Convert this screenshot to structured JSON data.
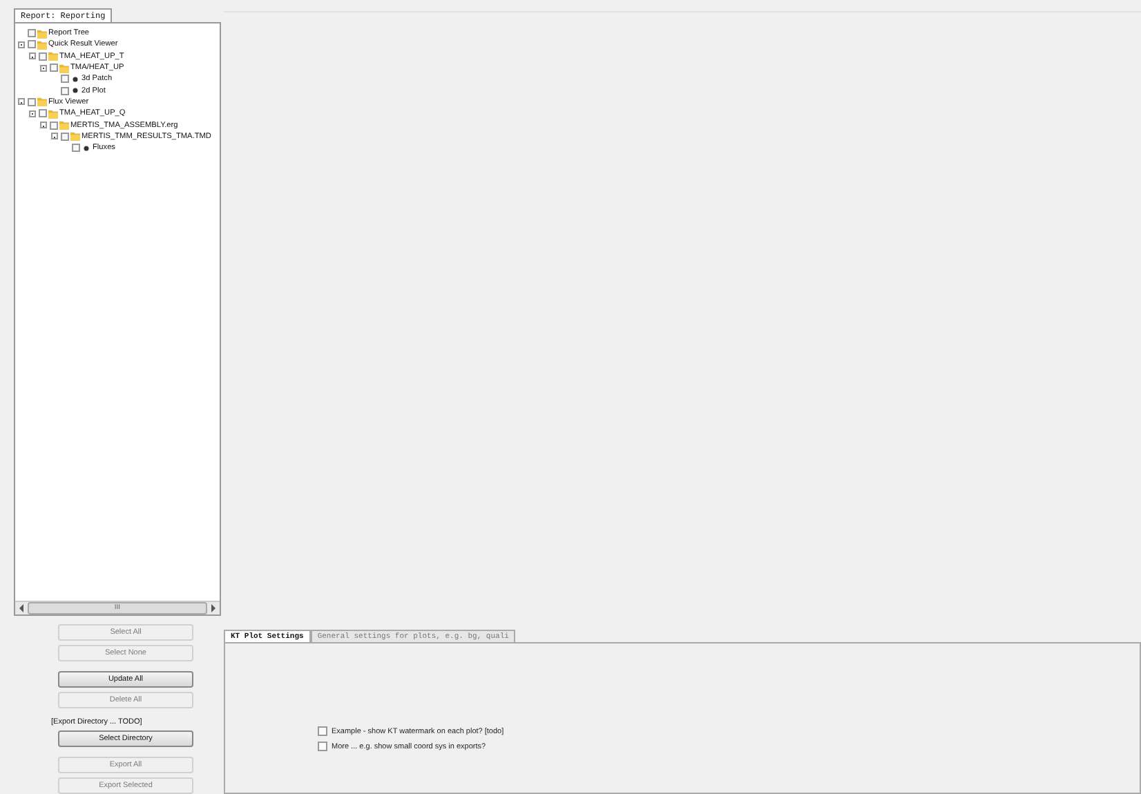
{
  "left_panel": {
    "tab": {
      "label": "Report: Reporting",
      "selected": true
    },
    "tree": [
      {
        "label": "Report Tree",
        "kind": "folder",
        "checked": false
      },
      {
        "label": "Quick Result Viewer",
        "kind": "folder",
        "checked": false,
        "expanded": true,
        "children": [
          {
            "label": "TMA_HEAT_UP_T",
            "kind": "folder",
            "checked": false,
            "expanded": true,
            "children": [
              {
                "label": "TMA/HEAT_UP",
                "kind": "folder",
                "checked": false,
                "expanded": true,
                "children": [
                  {
                    "label": "3d Patch",
                    "kind": "item",
                    "checked": false
                  },
                  {
                    "label": "2d Plot",
                    "kind": "item",
                    "checked": false
                  }
                ]
              }
            ]
          }
        ]
      },
      {
        "label": "Flux Viewer",
        "kind": "folder",
        "checked": false,
        "expanded": true,
        "children": [
          {
            "label": "TMA_HEAT_UP_Q",
            "kind": "folder",
            "checked": false,
            "expanded": true,
            "children": [
              {
                "label": "MERTIS_TMA_ASSEMBLY.erg",
                "kind": "folder",
                "checked": false,
                "expanded": true,
                "children": [
                  {
                    "label": "MERTIS_TMM_RESULTS_TMA.TMD",
                    "kind": "folder",
                    "checked": false,
                    "expanded": true,
                    "children": [
                      {
                        "label": "Fluxes",
                        "kind": "item",
                        "checked": false
                      }
                    ]
                  }
                ]
              }
            ]
          }
        ]
      }
    ],
    "scrollbar_grip": "III",
    "controls": [
      {
        "kind": "button",
        "label": "Select All",
        "disabled": true
      },
      {
        "kind": "button",
        "label": "Select None",
        "disabled": true
      },
      {
        "kind": "spacer"
      },
      {
        "kind": "button",
        "label": "Update All",
        "disabled": false
      },
      {
        "kind": "button",
        "label": "Delete All",
        "disabled": true
      },
      {
        "kind": "spacer"
      },
      {
        "kind": "label",
        "label": "[Export Directory ... TODO]"
      },
      {
        "kind": "button",
        "label": "Select Directory",
        "disabled": false
      },
      {
        "kind": "spacer"
      },
      {
        "kind": "button",
        "label": "Export All",
        "disabled": true
      },
      {
        "kind": "button",
        "label": "Export Selected",
        "disabled": true
      }
    ]
  },
  "settings": {
    "tabs": [
      {
        "label": "KT Plot Settings",
        "selected": true
      },
      {
        "label": "General settings for plots, e.g. bg, quali",
        "selected": false
      }
    ],
    "options": [
      {
        "label": "Example - show KT watermark on each plot? [todo]",
        "checked": false
      },
      {
        "label": "More ... e.g. show small coord sys in exports?",
        "checked": false
      }
    ]
  }
}
